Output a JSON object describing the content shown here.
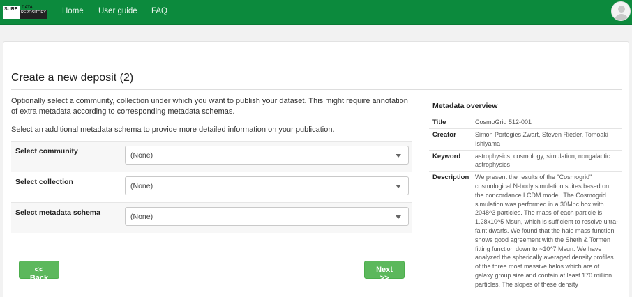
{
  "nav": {
    "logo_surf": "SURF",
    "logo_data": "DATA",
    "logo_repository": "REPOSITORY",
    "links": [
      "Home",
      "User guide",
      "FAQ"
    ]
  },
  "page": {
    "title": "Create a new deposit (2)",
    "intro": "Optionally select a community, collection under which you want to publish your dataset. This might require annotation of extra metadata according to corresponding metadata schemas.",
    "intro2": "Select an additional metadata schema to provide more detailed information on your publication."
  },
  "form": {
    "rows": [
      {
        "label": "Select community",
        "value": "(None)"
      },
      {
        "label": "Select collection",
        "value": "(None)"
      },
      {
        "label": "Select metadata schema",
        "value": "(None)"
      }
    ],
    "back_label": "<< Back",
    "next_label": "Next >>"
  },
  "metadata": {
    "heading": "Metadata overview",
    "rows": [
      {
        "key": "Title",
        "value": "CosmoGrid 512-001"
      },
      {
        "key": "Creator",
        "value": "Simon Portegies Zwart, Steven Rieder, Tomoaki Ishiyama"
      },
      {
        "key": "Keyword",
        "value": "astrophysics, cosmology, simulation, nongalactic astrophysics"
      },
      {
        "key": "Description",
        "value": "We present the results of the \"Cosmogrid\" cosmological N-body simulation suites based on the concordance LCDM model. The Cosmogrid simulation was performed in a 30Mpc box with 2048^3 particles. The mass of each particle is 1.28x10^5 Msun, which is sufficient to resolve ultra-faint dwarfs. We found that the halo mass function shows good agreement with the Sheth & Tormen fitting function down to ~10^7 Msun. We have analyzed the spherically averaged density profiles of the three most massive halos which are of galaxy group size and contain at least 170 million particles. The slopes of these density"
      }
    ]
  },
  "colors": {
    "navbar": "#0c8a3d",
    "button": "#5cb85c"
  },
  "icons": {
    "avatar": "user-avatar-icon",
    "select_caret": "caret-down-icon"
  }
}
